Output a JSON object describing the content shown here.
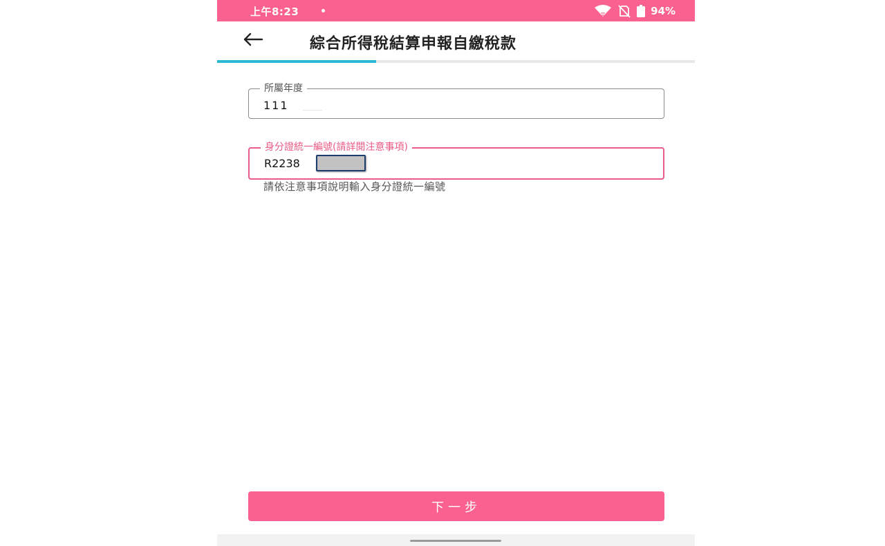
{
  "status_bar": {
    "time": "上午8:23",
    "battery": "94%",
    "background": "#fb6190",
    "icons": [
      "wifi-icon",
      "no-sim-icon",
      "battery-icon"
    ]
  },
  "app_bar": {
    "back_icon": "arrow-left-icon",
    "title": "綜合所得稅結算申報自繳稅款"
  },
  "progress": {
    "fraction": 0.333,
    "color": "#2cb7d2"
  },
  "form": {
    "year_field": {
      "label": "所屬年度",
      "value": "111"
    },
    "id_field": {
      "label": "身分證統一編號(請詳閱注意事項)",
      "value": "R2238",
      "helper": "請依注意事項說明輸入身分證統一編號",
      "accent": "#ec5a86"
    }
  },
  "footer": {
    "next_label": "下一步",
    "button_color": "#fb6190"
  }
}
